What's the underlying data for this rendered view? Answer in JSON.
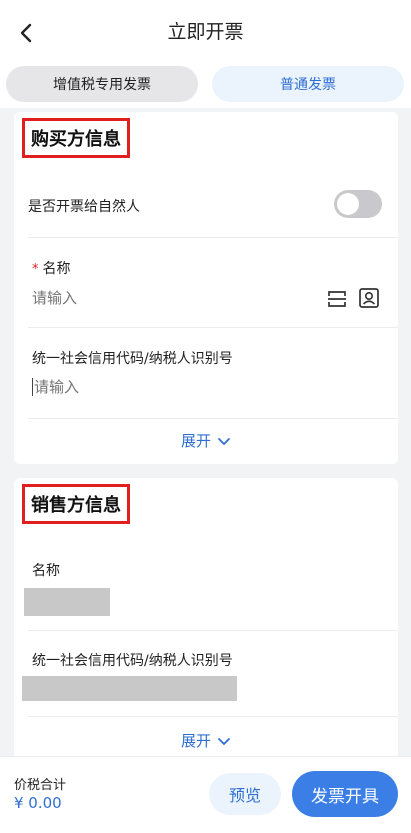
{
  "header": {
    "title": "立即开票"
  },
  "tabs": [
    {
      "label": "增值税专用发票"
    },
    {
      "label": "普通发票"
    }
  ],
  "buyer": {
    "section_title": "购买方信息",
    "natural_person_label": "是否开票给自然人",
    "natural_person_on": false,
    "name_label": "名称",
    "name_required_mark": "*",
    "name_placeholder": "请输入",
    "tax_id_label": "统一社会信用代码/纳税人识别号",
    "tax_id_placeholder": "请输入",
    "expand_label": "展开"
  },
  "seller": {
    "section_title": "销售方信息",
    "name_label": "名称",
    "tax_id_label": "统一社会信用代码/纳税人识别号",
    "expand_label": "展开"
  },
  "footer": {
    "total_label": "价税合计",
    "total_value": "¥ 0.00",
    "preview_label": "预览",
    "issue_label": "发票开具"
  },
  "colors": {
    "accent": "#3b7fe6",
    "link": "#2f6fd1",
    "highlight_border": "#e02020"
  }
}
